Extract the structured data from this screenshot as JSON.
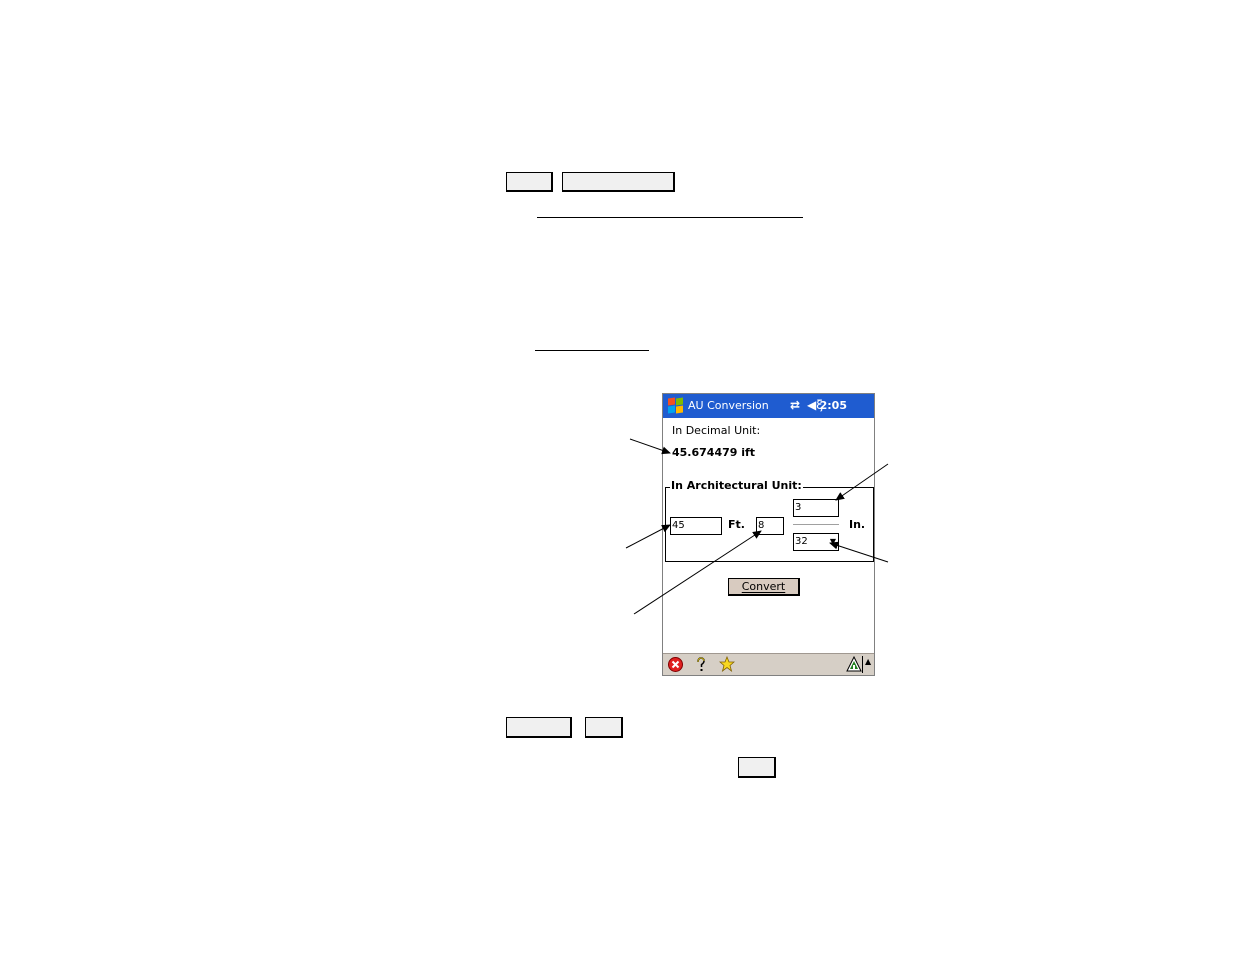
{
  "app": {
    "title": "AU Conversion",
    "clock": "2:05",
    "status_icons": [
      "sync-icon",
      "speaker-muted-icon"
    ]
  },
  "decimal": {
    "label": "In Decimal Unit:",
    "value": "45.674479 ift"
  },
  "architectural": {
    "group_label": "In Architectural Unit:",
    "feet_value": "45",
    "feet_label": "Ft.",
    "inches_value": "8",
    "numerator_value": "3",
    "denominator_value": "32",
    "inches_label": "In."
  },
  "convert_button": "Convert",
  "taskbar_icons": [
    "close-icon",
    "help-icon",
    "favorites-icon",
    "input-panel-icon",
    "up-arrow-icon"
  ],
  "colors": {
    "titlebar": "#1f5cd0",
    "taskbar": "#d6cfc6",
    "convert_button": "#d8cbc0"
  }
}
